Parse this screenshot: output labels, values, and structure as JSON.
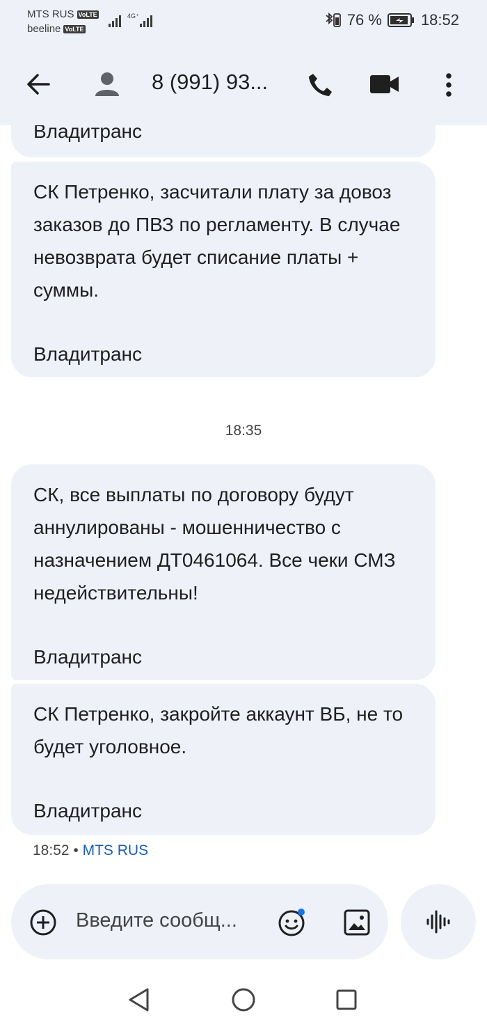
{
  "status": {
    "carrier1": "MTS RUS",
    "carrier2": "beeline",
    "volte": "VoLTE",
    "network": "4G⁺",
    "battery": "76 %",
    "time": "18:52"
  },
  "header": {
    "contact": "8 (991) 93..."
  },
  "messages": [
    {
      "partial": true,
      "signature": "Владитранс"
    },
    {
      "text": "СК Петренко, засчитали плату за довоз заказов до ПВЗ по регламенту. В случае невозврата будет списание платы + суммы.",
      "signature": "Владитранс"
    },
    {
      "text": "СК, все выплаты по договору будут аннулированы - мошенничество с назначением ДТ0461064. Все чеки СМЗ недействительны!",
      "signature": "Владитранс"
    },
    {
      "text": "СК Петренко, закройте аккаунт ВБ, не то будет уголовное.",
      "signature": "Владитранс"
    }
  ],
  "timestamp_separator": "18:35",
  "last_meta": {
    "time": "18:52",
    "dot": "•",
    "carrier": "MTS RUS"
  },
  "composer": {
    "placeholder": "Введите сообщ..."
  },
  "icons": {
    "back": "arrow-left-icon",
    "avatar": "person-icon",
    "call": "phone-icon",
    "video": "video-icon",
    "more": "more-vert-icon",
    "attach": "add-circle-icon",
    "emoji": "emoji-icon",
    "gallery": "image-icon",
    "voice": "voice-wave-icon"
  }
}
